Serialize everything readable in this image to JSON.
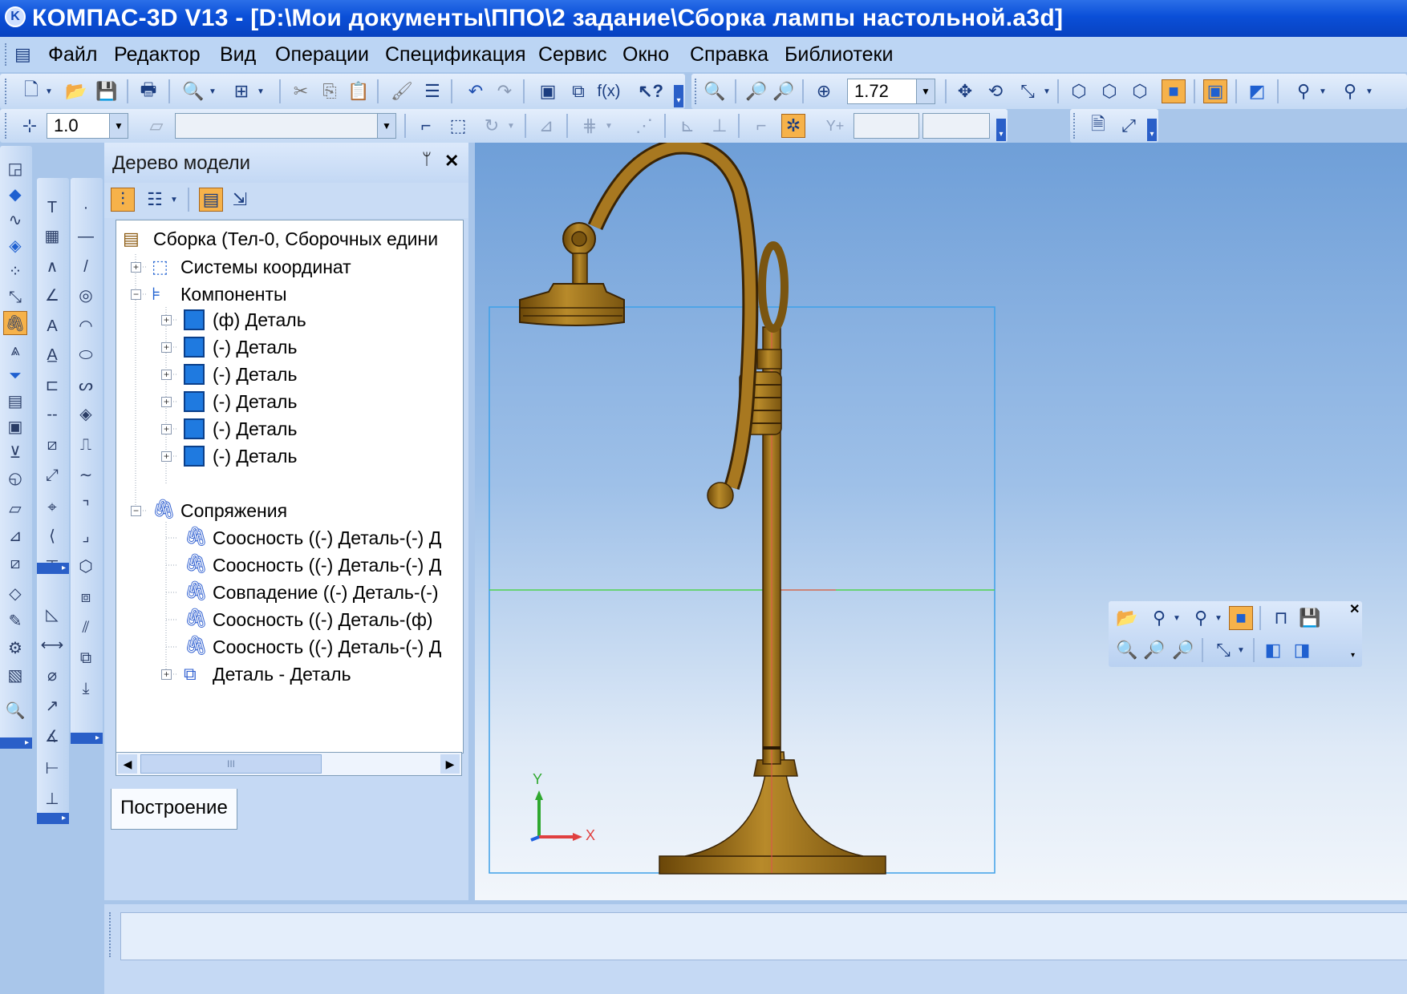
{
  "window": {
    "title": "КОМПАС-3D V13 - [D:\\Мои документы\\ППО\\2 задание\\Сборка лампы настольной.a3d]"
  },
  "menu": [
    "Файл",
    "Редактор",
    "Вид",
    "Операции",
    "Спецификация",
    "Сервис",
    "Окно",
    "Справка",
    "Библиотеки"
  ],
  "toolbar": {
    "zoom_value": "1.72",
    "step_value": "1.0"
  },
  "tree": {
    "title": "Дерево модели",
    "pin": "ᛘ",
    "close": "✕",
    "items": [
      {
        "label": "Сборка (Тел-0, Сборочных едини",
        "icon": "assembly-icon"
      },
      {
        "label": "Системы координат",
        "icon": "coordinate-systems-icon"
      },
      {
        "label": "Компоненты",
        "icon": "components-icon"
      },
      {
        "label": "(ф) Деталь",
        "icon": "part-icon"
      },
      {
        "label": "(-) Деталь",
        "icon": "part-icon"
      },
      {
        "label": "(-) Деталь",
        "icon": "part-icon"
      },
      {
        "label": "(-) Деталь",
        "icon": "part-icon"
      },
      {
        "label": "(-) Деталь",
        "icon": "part-icon"
      },
      {
        "label": "(-) Деталь",
        "icon": "part-icon"
      },
      {
        "label": "Сопряжения",
        "icon": "mates-icon"
      },
      {
        "label": "Соосность ((-) Деталь-(-) Д",
        "icon": "mate-icon"
      },
      {
        "label": "Соосность ((-) Деталь-(-) Д",
        "icon": "mate-icon"
      },
      {
        "label": "Совпадение ((-) Деталь-(-)",
        "icon": "mate-icon"
      },
      {
        "label": "Соосность ((-) Деталь-(ф)",
        "icon": "mate-icon"
      },
      {
        "label": "Соосность ((-) Деталь-(-) Д",
        "icon": "mate-icon"
      },
      {
        "label": "Деталь - Деталь",
        "icon": "pattern-icon"
      }
    ],
    "tab": "Построение",
    "scroll_grip": "III"
  },
  "viewport": {
    "axis_x": "X",
    "axis_y": "Y"
  },
  "colors": {
    "titlebar": "#0a4fd8",
    "menubar": "#bcd5f4",
    "highlight": "#f6b24a",
    "lamp": "#a87820",
    "frame": "#3fa0e8"
  }
}
